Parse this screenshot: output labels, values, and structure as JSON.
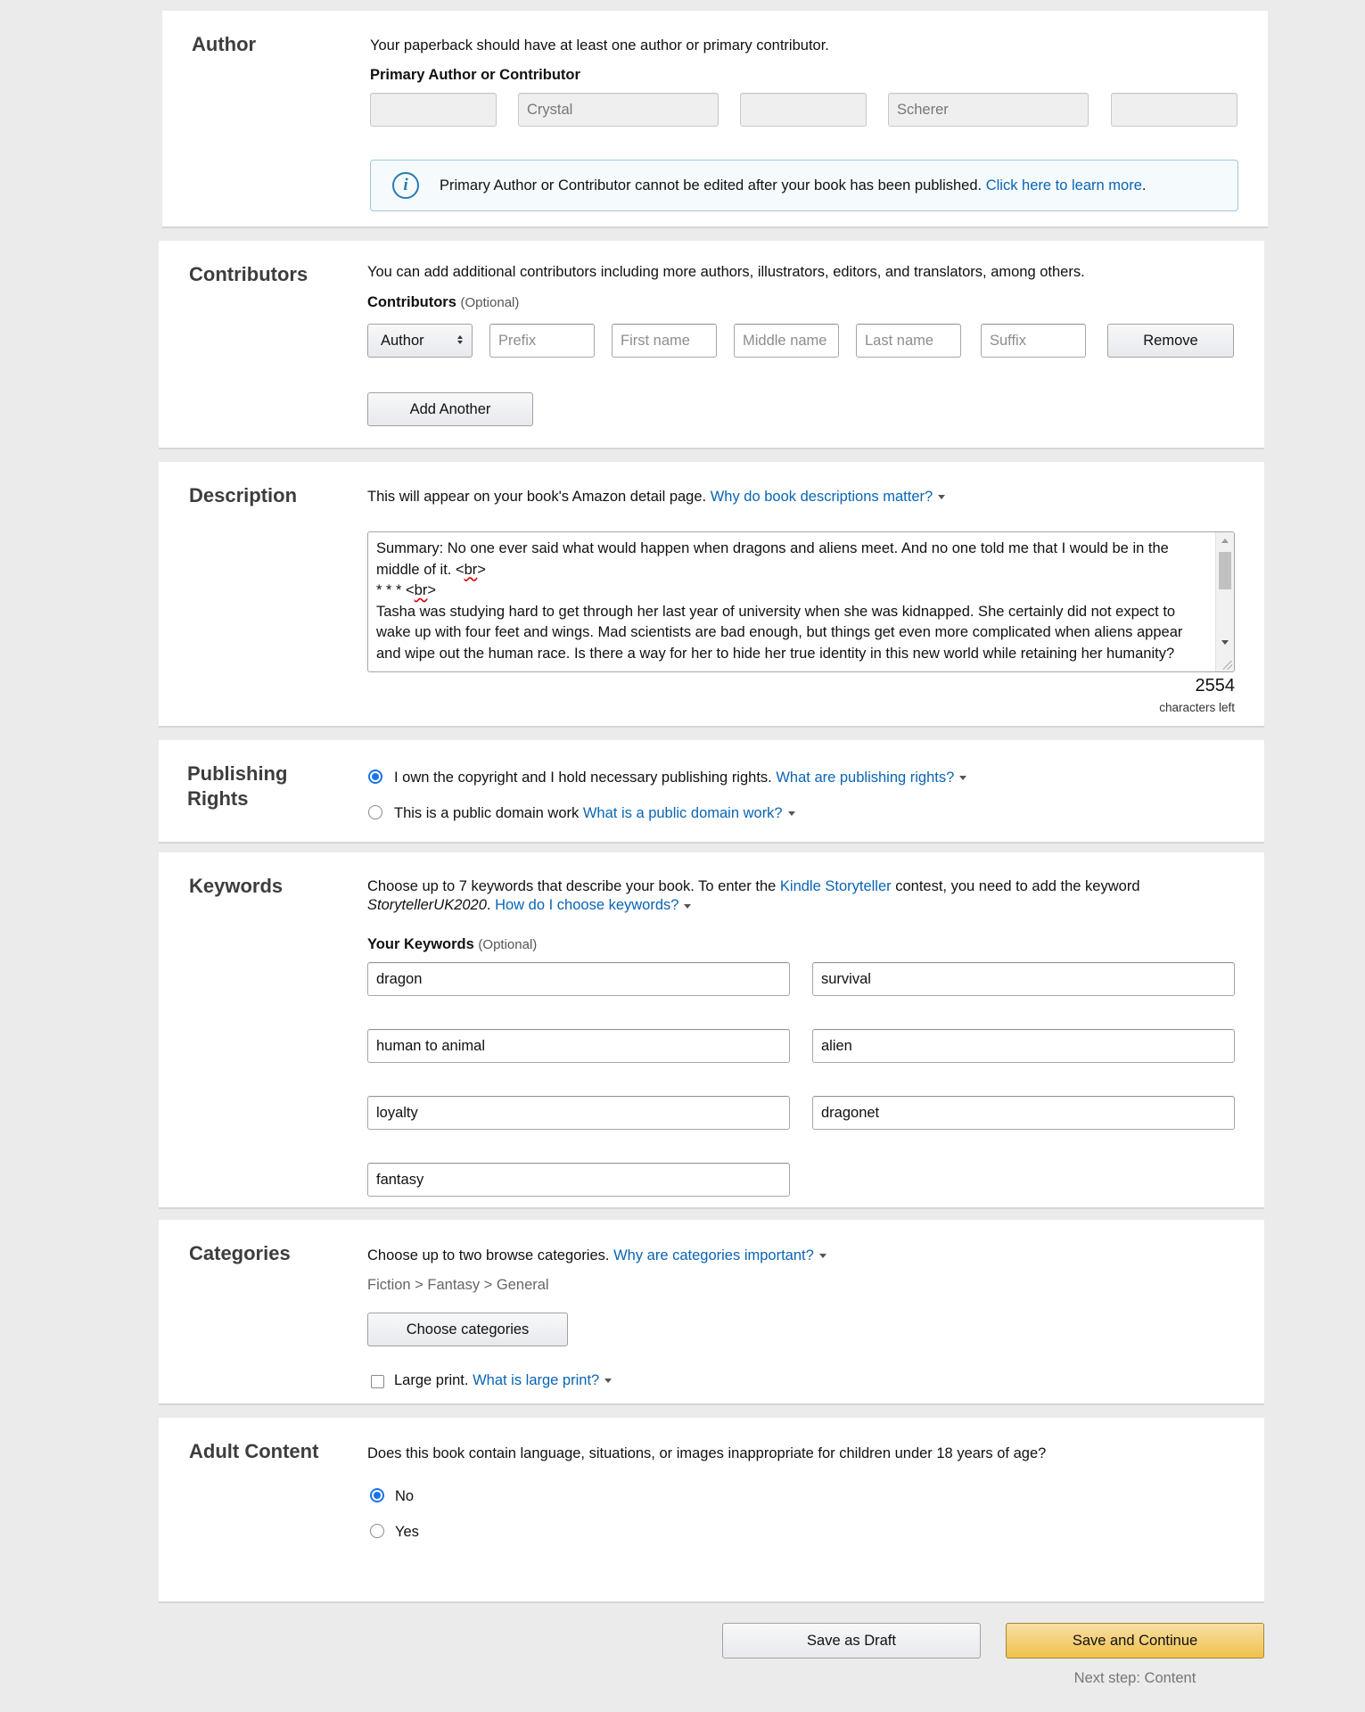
{
  "author": {
    "heading": "Author",
    "intro": "Your paperback should have at least one author or primary contributor.",
    "primary_label": "Primary Author or Contributor",
    "fields": [
      "",
      "Crystal",
      "",
      "Scherer",
      ""
    ],
    "info_text": "Primary Author or Contributor cannot be edited after your book has been published.",
    "info_link": "Click here to learn more",
    "info_end": "."
  },
  "contributors": {
    "heading": "Contributors",
    "intro": "You can add additional contributors including more authors, illustrators, editors, and translators, among others.",
    "label": "Contributors",
    "optional": "(Optional)",
    "role": "Author",
    "placeholders": {
      "prefix": "Prefix",
      "first": "First name",
      "middle": "Middle name",
      "last": "Last name",
      "suffix": "Suffix"
    },
    "remove_label": "Remove",
    "add_label": "Add Another"
  },
  "description": {
    "heading": "Description",
    "intro": "This will appear on your book's Amazon detail page.",
    "link": "Why do book descriptions matter?",
    "line1": "Summary: No one ever said what would happen when dragons and aliens meet. And no one told me that I would be in the",
    "line2a": "middle of it.   <",
    "line2b": "br",
    "line2c": ">",
    "line3a": "*   *   *   <",
    "line3b": "br",
    "line3c": ">",
    "line4": "Tasha was studying hard to get through her last year of university when she was kidnapped. She certainly did not expect to",
    "line5": "wake up with four feet and wings. Mad scientists are bad enough, but things get even more complicated when aliens appear",
    "line6": "and wipe out the human race. Is there a way for her to hide her true identity in this new world while retaining her humanity?",
    "chars_left": "2554",
    "chars_left_label": "characters left"
  },
  "publishing_rights": {
    "heading_line1": "Publishing",
    "heading_line2": "Rights",
    "option1": "I own the copyright and I hold necessary publishing rights.",
    "option1_link": "What are publishing rights?",
    "option2": "This is a public domain work",
    "option2_link": "What is a public domain work?"
  },
  "keywords": {
    "heading": "Keywords",
    "intro_a": "Choose up to 7 keywords that describe your book. To enter the",
    "intro_link1": "Kindle Storyteller",
    "intro_b": "contest, you need to add the keyword",
    "intro_italic": "StorytellerUK2020",
    "intro_c": ".",
    "intro_link2": "How do I choose keywords?",
    "label": "Your Keywords",
    "optional": "(Optional)",
    "values": [
      "dragon",
      "survival",
      "human to animal",
      "alien",
      "loyalty",
      "dragonet",
      "fantasy"
    ]
  },
  "categories": {
    "heading": "Categories",
    "intro": "Choose up to two browse categories.",
    "link": "Why are categories important?",
    "path": "Fiction > Fantasy > General",
    "button": "Choose categories",
    "large_print": "Large print.",
    "large_print_link": "What is large print?"
  },
  "adult": {
    "heading": "Adult Content",
    "question": "Does this book contain language, situations, or images inappropriate for children under 18 years of age?",
    "no": "No",
    "yes": "Yes"
  },
  "footer": {
    "draft": "Save as Draft",
    "continue": "Save and Continue",
    "next_step": "Next step: Content"
  },
  "colors": {
    "link": "#0a64b4",
    "primary_button": "#f0c14b",
    "radio_selected": "#1a73e8"
  }
}
